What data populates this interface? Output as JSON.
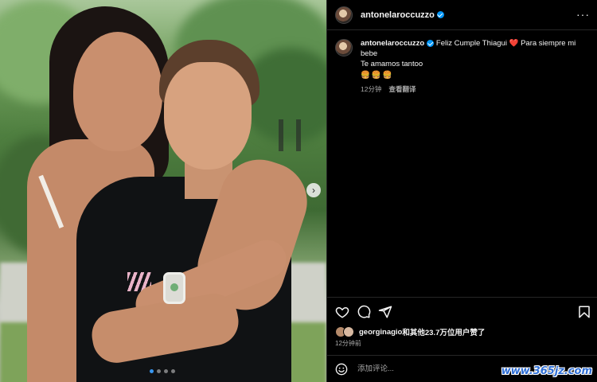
{
  "post": {
    "username": "antonelaroccuzzo",
    "verified": true,
    "more_icon": "more-horizontal-icon"
  },
  "caption": {
    "username": "antonelaroccuzzo",
    "text_line1": "Feliz Cumple Thiagui",
    "heart": "❤️",
    "text_line1_end": "Para siempre mi bebe",
    "text_line2": "Te amamos tantoo",
    "emojis": "🍔🍔🍔",
    "time": "12分钟",
    "translate": "查看翻译"
  },
  "media": {
    "carousel_dots": 4,
    "active_dot": 0,
    "next_icon": "chevron-right-icon"
  },
  "actions": {
    "like_icon": "heart-icon",
    "comment_icon": "comment-icon",
    "share_icon": "send-icon",
    "save_icon": "bookmark-icon"
  },
  "likes": {
    "first_user": "georginagio",
    "rest_text": "和其他23.7万位用户赞了"
  },
  "timestamp": "12分钟前",
  "comment_box": {
    "emoji_icon": "smiley-icon",
    "placeholder": "添加评论..."
  },
  "watermark": "www.365jz.com",
  "colors": {
    "background": "#000000",
    "text": "#f5f5f5",
    "muted": "#a8a8a8",
    "verified": "#0095f6",
    "heart": "#e0245e"
  }
}
